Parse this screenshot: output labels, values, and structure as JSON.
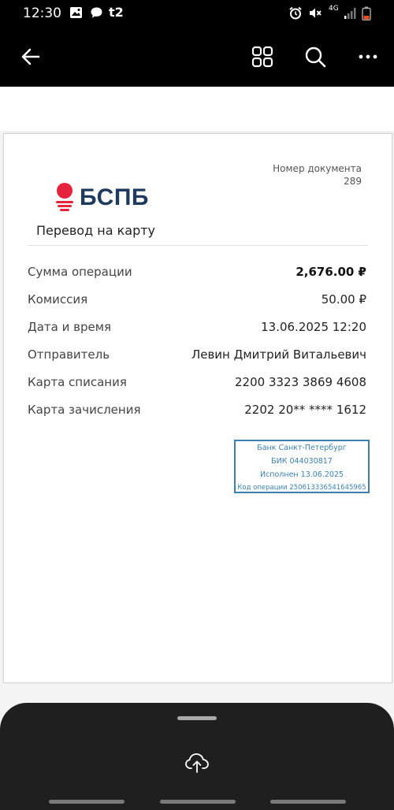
{
  "status_bar": {
    "time": "12:30",
    "carrier": "t2",
    "network": "4G",
    "icons": [
      "image-icon",
      "chat-icon",
      "alarm-icon",
      "mute-icon",
      "signal-icon",
      "battery-icon"
    ]
  },
  "toolbar": {
    "icons": [
      "back-arrow-icon",
      "grid-icon",
      "search-icon",
      "more-icon"
    ]
  },
  "document": {
    "number_label": "Номер документа",
    "number_value": "289",
    "bank_name": "БСПБ",
    "title": "Перевод на карту",
    "rows": [
      {
        "label": "Сумма операции",
        "value": "2,676.00 ₽"
      },
      {
        "label": "Комиссия",
        "value": "50.00 ₽"
      },
      {
        "label": "Дата и время",
        "value": "13.06.2025 12:20"
      },
      {
        "label": "Отправитель",
        "value": "Левин Дмитрий Витальевич"
      },
      {
        "label": "Карта списания",
        "value": "2200 3323 3869 4608"
      },
      {
        "label": "Карта зачисления",
        "value": "2202 20** **** 1612"
      }
    ],
    "stamp": {
      "line1": "Банк Санкт-Петербург",
      "line2": "БИК 044030817",
      "line3": "Исполнен 13.06.2025",
      "line4": "Код операции 250613336541645965"
    }
  },
  "bottom_sheet": {
    "icons": [
      "cloud-upload-icon"
    ]
  },
  "colors": {
    "brand_red": "#e5243b",
    "brand_navy": "#1f3a5f",
    "stamp_blue": "#3b80b3",
    "chrome_black": "#000000",
    "sheet_dark": "#1f1f1f"
  }
}
